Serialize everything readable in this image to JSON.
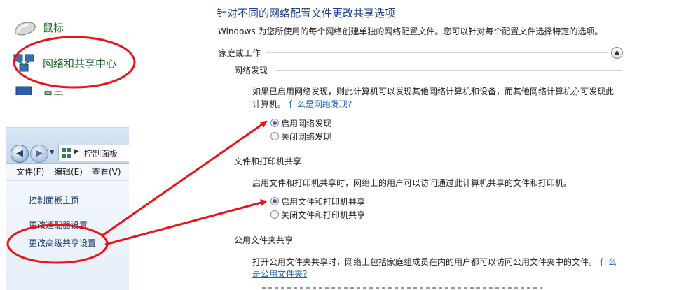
{
  "control_panel_items": [
    {
      "label": "鼠标",
      "icon": "mouse-icon"
    },
    {
      "label": "网络和共享中心",
      "icon": "network-icon"
    },
    {
      "label": "显示",
      "icon": "display-icon"
    }
  ],
  "explorer": {
    "breadcrumb": "控制面板",
    "menu": [
      "文件(F)",
      "编辑(E)",
      "查看(V)"
    ],
    "side_links": [
      "控制面板主页",
      "更改适配器设置",
      "更改高级共享设置"
    ]
  },
  "settings": {
    "title": "针对不同的网络配置文件更改共享选项",
    "subtitle": "Windows 为您所使用的每个网络创建单独的网络配置文件。您可以针对每个配置文件选择特定的选项。",
    "profile_name": "家庭或工作",
    "network_discovery": {
      "heading": "网络发现",
      "desc_line1": "如果已启用网络发现，则此计算机可以发现其他网络计算机和设备，而其他网络计算机亦可发现此",
      "desc_line2": "计算机。",
      "help_link": "什么是网络发现?",
      "options": [
        "启用网络发现",
        "关闭网络发现"
      ]
    },
    "file_printer_sharing": {
      "heading": "文件和打印机共享",
      "desc": "启用文件和打印机共享时，网络上的用户可以访问通过此计算机共享的文件和打印机。",
      "options": [
        "启用文件和打印机共享",
        "关闭文件和打印机共享"
      ]
    },
    "public_folder_sharing": {
      "heading": "公用文件夹共享",
      "desc_line1": "打开公用文件夹共享时，网络上包括家庭组成员在内的用户都可以访问公用文件夹中的文件。",
      "help_link_part1": "什么",
      "help_link_part2": "是公用文件夹?"
    }
  },
  "colors": {
    "annotation": "#e8141a",
    "title": "#1e3f8a",
    "link": "#1a5fb4",
    "cp_label": "#1e6a28"
  }
}
